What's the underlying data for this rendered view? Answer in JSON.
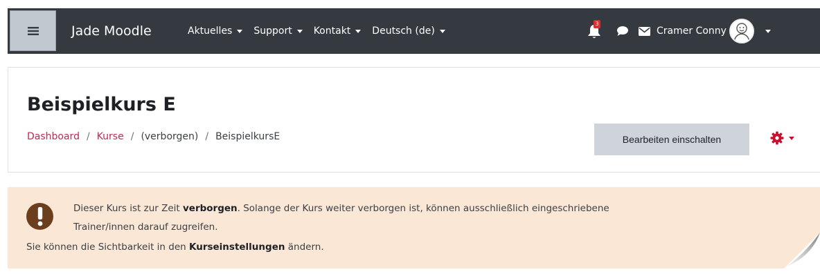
{
  "navbar": {
    "brand": "Jade Moodle",
    "menu": [
      {
        "label": "Aktuelles"
      },
      {
        "label": "Support"
      },
      {
        "label": "Kontakt"
      },
      {
        "label": "Deutsch (de)"
      }
    ],
    "notification_count": "3",
    "user_name": "Cramer Conny",
    "icons": [
      "hamburger-icon",
      "bell-icon",
      "chat-icon",
      "envelope-icon",
      "avatar",
      "chevron-down-icon"
    ]
  },
  "header": {
    "title": "Beispielkurs E",
    "breadcrumb": {
      "items": [
        "Dashboard",
        "Kurse",
        "(verborgen)",
        "BeispielkursE"
      ],
      "separator": "/"
    },
    "edit_button": "Bearbeiten einschalten"
  },
  "alert": {
    "line1_before": "Dieser Kurs ist zur Zeit ",
    "line1_bold": "verborgen",
    "line1_after": ". Solange der Kurs weiter verborgen ist, können ausschließlich eingeschriebene",
    "line2": "Trainer/innen darauf zugreifen.",
    "line3_before": "Sie können die Sichtbarkeit in den ",
    "line3_bold": "Kurseinstellungen",
    "line3_after": " ändern."
  },
  "colors": {
    "navbar_bg": "#343a40",
    "link": "#c8264d",
    "gear": "#c8102e",
    "alert_bg": "#fbe7d5",
    "alert_icon": "#6b3f1e",
    "button_bg": "#ced4da",
    "badge": "#e02d2d"
  }
}
